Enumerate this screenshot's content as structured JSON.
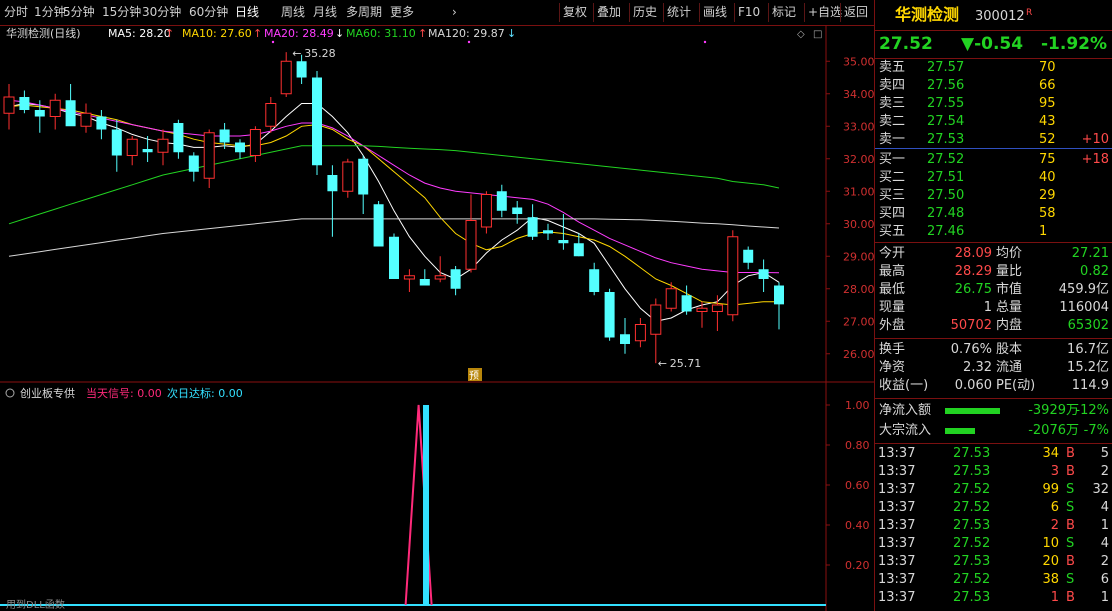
{
  "toolbar": {
    "periods": [
      "分时",
      "1分钟",
      "5分钟",
      "15分钟",
      "30分钟",
      "60分钟",
      "日线",
      "周线",
      "月线",
      "多周期",
      "更多"
    ],
    "active_period": "日线",
    "tools": [
      "复权",
      "叠加",
      "历史",
      "统计",
      "画线",
      "F10",
      "标记",
      "+自选",
      "返回"
    ]
  },
  "main_chart": {
    "title": "华测检测(日线)",
    "ma": [
      {
        "label": "MA5: 28.20",
        "color": "#ffffff"
      },
      {
        "label": "MA10: 27.60",
        "color": "#ffd700"
      },
      {
        "label": "MA20: 28.49",
        "color": "#ff3cff"
      },
      {
        "label": "MA60: 31.10",
        "color": "#22d322"
      },
      {
        "label": "MA120: 29.87",
        "color": "#d8d8d8"
      }
    ],
    "high_label": "35.28",
    "low_label": "25.71",
    "forecast_badge": "预",
    "y_ticks": [
      "35.00",
      "34.00",
      "33.00",
      "32.00",
      "31.00",
      "30.00",
      "29.00",
      "28.00",
      "27.00",
      "26.00"
    ]
  },
  "indicator": {
    "title": "创业板专供",
    "signal_today": "当天信号: 0.00",
    "signal_next": "次日达标: 0.00",
    "y_ticks": [
      "1.00",
      "0.80",
      "0.60",
      "0.40",
      "0.20"
    ],
    "footer": "用到DLL函数"
  },
  "chart_data": {
    "type": "candlestick",
    "y_range": [
      25.5,
      35.5
    ],
    "candles": [
      {
        "o": 33.4,
        "h": 34.3,
        "l": 32.9,
        "c": 33.9
      },
      {
        "o": 33.9,
        "h": 34.1,
        "l": 33.4,
        "c": 33.5
      },
      {
        "o": 33.5,
        "h": 33.8,
        "l": 32.8,
        "c": 33.3
      },
      {
        "o": 33.3,
        "h": 34.0,
        "l": 32.9,
        "c": 33.8
      },
      {
        "o": 33.8,
        "h": 34.3,
        "l": 33.2,
        "c": 33.0
      },
      {
        "o": 33.0,
        "h": 33.7,
        "l": 32.8,
        "c": 33.4
      },
      {
        "o": 33.3,
        "h": 33.5,
        "l": 32.6,
        "c": 32.9
      },
      {
        "o": 32.9,
        "h": 33.2,
        "l": 31.6,
        "c": 32.1
      },
      {
        "o": 32.1,
        "h": 32.7,
        "l": 31.8,
        "c": 32.6
      },
      {
        "o": 32.3,
        "h": 32.7,
        "l": 31.9,
        "c": 32.2
      },
      {
        "o": 32.2,
        "h": 32.9,
        "l": 31.8,
        "c": 32.6
      },
      {
        "o": 33.1,
        "h": 33.2,
        "l": 32.0,
        "c": 32.2
      },
      {
        "o": 32.1,
        "h": 32.2,
        "l": 31.3,
        "c": 31.6
      },
      {
        "o": 31.4,
        "h": 32.9,
        "l": 31.1,
        "c": 32.8
      },
      {
        "o": 32.9,
        "h": 33.1,
        "l": 32.3,
        "c": 32.5
      },
      {
        "o": 32.5,
        "h": 32.6,
        "l": 32.0,
        "c": 32.2
      },
      {
        "o": 32.1,
        "h": 33.0,
        "l": 31.9,
        "c": 32.9
      },
      {
        "o": 33.0,
        "h": 33.9,
        "l": 32.8,
        "c": 33.7
      },
      {
        "o": 34.0,
        "h": 35.28,
        "l": 33.9,
        "c": 35.0
      },
      {
        "o": 35.0,
        "h": 35.2,
        "l": 34.3,
        "c": 34.5
      },
      {
        "o": 34.5,
        "h": 34.7,
        "l": 31.5,
        "c": 31.8
      },
      {
        "o": 31.5,
        "h": 31.8,
        "l": 29.6,
        "c": 31.0
      },
      {
        "o": 31.0,
        "h": 32.0,
        "l": 30.8,
        "c": 31.9
      },
      {
        "o": 32.0,
        "h": 32.1,
        "l": 30.3,
        "c": 30.9
      },
      {
        "o": 30.6,
        "h": 30.7,
        "l": 29.3,
        "c": 29.3
      },
      {
        "o": 29.6,
        "h": 29.7,
        "l": 28.3,
        "c": 28.3
      },
      {
        "o": 28.3,
        "h": 28.6,
        "l": 27.9,
        "c": 28.4
      },
      {
        "o": 28.3,
        "h": 28.6,
        "l": 28.1,
        "c": 28.1
      },
      {
        "o": 28.3,
        "h": 29.0,
        "l": 28.2,
        "c": 28.4
      },
      {
        "o": 28.6,
        "h": 28.7,
        "l": 27.8,
        "c": 28.0
      },
      {
        "o": 28.6,
        "h": 30.9,
        "l": 28.5,
        "c": 30.1
      },
      {
        "o": 29.9,
        "h": 31.0,
        "l": 29.7,
        "c": 30.9
      },
      {
        "o": 31.0,
        "h": 31.2,
        "l": 30.2,
        "c": 30.4
      },
      {
        "o": 30.5,
        "h": 30.7,
        "l": 30.0,
        "c": 30.3
      },
      {
        "o": 30.2,
        "h": 30.6,
        "l": 29.5,
        "c": 29.6
      },
      {
        "o": 29.8,
        "h": 30.0,
        "l": 29.5,
        "c": 29.7
      },
      {
        "o": 29.5,
        "h": 30.3,
        "l": 29.2,
        "c": 29.4
      },
      {
        "o": 29.4,
        "h": 29.7,
        "l": 29.0,
        "c": 29.0
      },
      {
        "o": 28.6,
        "h": 28.8,
        "l": 27.8,
        "c": 27.9
      },
      {
        "o": 27.9,
        "h": 28.0,
        "l": 26.4,
        "c": 26.5
      },
      {
        "o": 26.6,
        "h": 27.1,
        "l": 26.0,
        "c": 26.3
      },
      {
        "o": 26.4,
        "h": 27.1,
        "l": 26.2,
        "c": 26.9
      },
      {
        "o": 26.6,
        "h": 27.7,
        "l": 25.71,
        "c": 27.5
      },
      {
        "o": 27.4,
        "h": 28.2,
        "l": 27.3,
        "c": 28.0
      },
      {
        "o": 27.8,
        "h": 28.1,
        "l": 27.2,
        "c": 27.3
      },
      {
        "o": 27.3,
        "h": 27.6,
        "l": 26.8,
        "c": 27.4
      },
      {
        "o": 27.3,
        "h": 27.8,
        "l": 26.7,
        "c": 27.5
      },
      {
        "o": 27.2,
        "h": 29.8,
        "l": 27.0,
        "c": 29.6
      },
      {
        "o": 29.2,
        "h": 29.3,
        "l": 28.6,
        "c": 28.8
      },
      {
        "o": 28.6,
        "h": 28.9,
        "l": 27.9,
        "c": 28.3
      },
      {
        "o": 28.1,
        "h": 28.2,
        "l": 26.75,
        "c": 27.52
      }
    ],
    "ma5": [
      33.6,
      33.7,
      33.65,
      33.55,
      33.4,
      33.3,
      33.1,
      32.95,
      32.75,
      32.6,
      32.5,
      32.45,
      32.35,
      32.35,
      32.4,
      32.35,
      32.45,
      32.85,
      33.3,
      33.7,
      33.7,
      33.3,
      32.8,
      32.1,
      31.3,
      30.4,
      29.6,
      29.0,
      28.5,
      28.3,
      28.6,
      29.1,
      29.5,
      29.8,
      30.2,
      30.1,
      29.9,
      29.7,
      29.4,
      28.7,
      28.0,
      27.4,
      27.0,
      27.1,
      27.35,
      27.5,
      27.6,
      28.1,
      28.4,
      28.5,
      28.2
    ],
    "ma10": [
      33.6,
      33.65,
      33.6,
      33.55,
      33.5,
      33.4,
      33.3,
      33.2,
      33.05,
      32.95,
      32.85,
      32.75,
      32.6,
      32.5,
      32.45,
      32.4,
      32.4,
      32.5,
      32.7,
      33.0,
      33.05,
      32.9,
      32.6,
      32.4,
      32.0,
      31.6,
      31.2,
      30.8,
      30.2,
      29.7,
      29.4,
      29.2,
      29.3,
      29.55,
      29.7,
      29.75,
      29.7,
      29.6,
      29.5,
      29.3,
      29.0,
      28.65,
      28.3,
      28.1,
      27.85,
      27.6,
      27.55,
      27.5,
      27.55,
      27.6,
      27.6
    ],
    "ma20": [
      33.8,
      33.75,
      33.65,
      33.55,
      33.45,
      33.35,
      33.25,
      33.15,
      33.05,
      32.95,
      32.85,
      32.8,
      32.75,
      32.7,
      32.7,
      32.7,
      32.75,
      32.85,
      33.0,
      33.1,
      33.1,
      32.95,
      32.7,
      32.4,
      32.1,
      31.8,
      31.5,
      31.25,
      31.1,
      31.0,
      30.95,
      30.9,
      30.85,
      30.8,
      30.75,
      30.6,
      30.35,
      30.05,
      29.8,
      29.55,
      29.35,
      29.15,
      28.95,
      28.8,
      28.7,
      28.6,
      28.55,
      28.5,
      28.5,
      28.5,
      28.49
    ],
    "ma60": [
      30.0,
      30.15,
      30.3,
      30.45,
      30.6,
      30.75,
      30.9,
      31.05,
      31.2,
      31.35,
      31.5,
      31.6,
      31.7,
      31.8,
      31.9,
      32.0,
      32.1,
      32.2,
      32.3,
      32.4,
      32.4,
      32.4,
      32.4,
      32.4,
      32.38,
      32.35,
      32.32,
      32.3,
      32.28,
      32.25,
      32.2,
      32.15,
      32.1,
      32.05,
      32.0,
      31.95,
      31.9,
      31.85,
      31.8,
      31.75,
      31.7,
      31.65,
      31.6,
      31.55,
      31.5,
      31.45,
      31.4,
      31.3,
      31.25,
      31.2,
      31.1
    ],
    "ma120": [
      29.0,
      29.07,
      29.14,
      29.21,
      29.28,
      29.35,
      29.42,
      29.49,
      29.56,
      29.63,
      29.7,
      29.75,
      29.8,
      29.85,
      29.9,
      29.95,
      30.0,
      30.05,
      30.1,
      30.15,
      30.15,
      30.15,
      30.15,
      30.15,
      30.15,
      30.15,
      30.15,
      30.15,
      30.15,
      30.15,
      30.15,
      30.15,
      30.15,
      30.15,
      30.15,
      30.15,
      30.15,
      30.15,
      30.15,
      30.14,
      30.13,
      30.12,
      30.1,
      30.08,
      30.05,
      30.02,
      30.0,
      29.97,
      29.93,
      29.9,
      29.87
    ],
    "indicator_series": {
      "当天信号": {
        "index": 29,
        "value": 1.0,
        "color": "#ff2a7a"
      },
      "次日达标": {
        "index": 30,
        "value": 1.0,
        "color": "#33e0ff"
      }
    }
  },
  "quote": {
    "name": "华测检测",
    "code": "300012",
    "flag": "R",
    "price": "27.52",
    "change": "▼-0.54",
    "pct": "-1.92%",
    "asks": [
      {
        "label": "卖五",
        "price": "27.57",
        "vol": "70",
        "chg": ""
      },
      {
        "label": "卖四",
        "price": "27.56",
        "vol": "66",
        "chg": ""
      },
      {
        "label": "卖三",
        "price": "27.55",
        "vol": "95",
        "chg": ""
      },
      {
        "label": "卖二",
        "price": "27.54",
        "vol": "43",
        "chg": ""
      },
      {
        "label": "卖一",
        "price": "27.53",
        "vol": "52",
        "chg": "+10"
      }
    ],
    "bids": [
      {
        "label": "买一",
        "price": "27.52",
        "vol": "75",
        "chg": "+18"
      },
      {
        "label": "买二",
        "price": "27.51",
        "vol": "40",
        "chg": ""
      },
      {
        "label": "买三",
        "price": "27.50",
        "vol": "29",
        "chg": ""
      },
      {
        "label": "买四",
        "price": "27.48",
        "vol": "58",
        "chg": ""
      },
      {
        "label": "买五",
        "price": "27.46",
        "vol": "1",
        "chg": ""
      }
    ],
    "stats1": [
      {
        "l1": "今开",
        "v1": "28.09",
        "c1": "r",
        "l2": "均价",
        "v2": "27.21",
        "c2": "g"
      },
      {
        "l1": "最高",
        "v1": "28.29",
        "c1": "r",
        "l2": "量比",
        "v2": "0.82",
        "c2": "g"
      },
      {
        "l1": "最低",
        "v1": "26.75",
        "c1": "g",
        "l2": "市值",
        "v2": "459.9亿",
        "c2": "w"
      },
      {
        "l1": "现量",
        "v1": "1",
        "c1": "w",
        "l2": "总量",
        "v2": "116004",
        "c2": "w"
      },
      {
        "l1": "外盘",
        "v1": "50702",
        "c1": "r",
        "l2": "内盘",
        "v2": "65302",
        "c2": "g"
      }
    ],
    "stats2": [
      {
        "l1": "换手",
        "v1": "0.76%",
        "l2": "股本",
        "v2": "16.7亿"
      },
      {
        "l1": "净资",
        "v1": "2.32",
        "l2": "流通",
        "v2": "15.2亿"
      },
      {
        "l1": "收益(一)",
        "v1": "0.060",
        "l2": "PE(动)",
        "v2": "114.9"
      }
    ],
    "flows": [
      {
        "label": "净流入额",
        "value": "-3929万",
        "pct": "-12%",
        "bar": 0.55
      },
      {
        "label": "大宗流入",
        "value": "-2076万",
        "pct": "-7%",
        "bar": 0.3
      }
    ],
    "ticks": [
      {
        "t": "13:37",
        "p": "27.53",
        "pc": "g",
        "v": "34",
        "vc": "y",
        "d": "B",
        "dc": "r",
        "n": "5"
      },
      {
        "t": "13:37",
        "p": "27.53",
        "pc": "g",
        "v": "3",
        "vc": "r",
        "d": "B",
        "dc": "r",
        "n": "2"
      },
      {
        "t": "13:37",
        "p": "27.52",
        "pc": "g",
        "v": "99",
        "vc": "y",
        "d": "S",
        "dc": "g",
        "n": "32"
      },
      {
        "t": "13:37",
        "p": "27.52",
        "pc": "g",
        "v": "6",
        "vc": "y",
        "d": "S",
        "dc": "g",
        "n": "4"
      },
      {
        "t": "13:37",
        "p": "27.53",
        "pc": "g",
        "v": "2",
        "vc": "r",
        "d": "B",
        "dc": "r",
        "n": "1"
      },
      {
        "t": "13:37",
        "p": "27.52",
        "pc": "g",
        "v": "10",
        "vc": "y",
        "d": "S",
        "dc": "g",
        "n": "4"
      },
      {
        "t": "13:37",
        "p": "27.53",
        "pc": "g",
        "v": "20",
        "vc": "y",
        "d": "B",
        "dc": "r",
        "n": "2"
      },
      {
        "t": "13:37",
        "p": "27.52",
        "pc": "g",
        "v": "38",
        "vc": "y",
        "d": "S",
        "dc": "g",
        "n": "6"
      },
      {
        "t": "13:37",
        "p": "27.53",
        "pc": "g",
        "v": "1",
        "vc": "r",
        "d": "B",
        "dc": "r",
        "n": "1"
      }
    ]
  }
}
